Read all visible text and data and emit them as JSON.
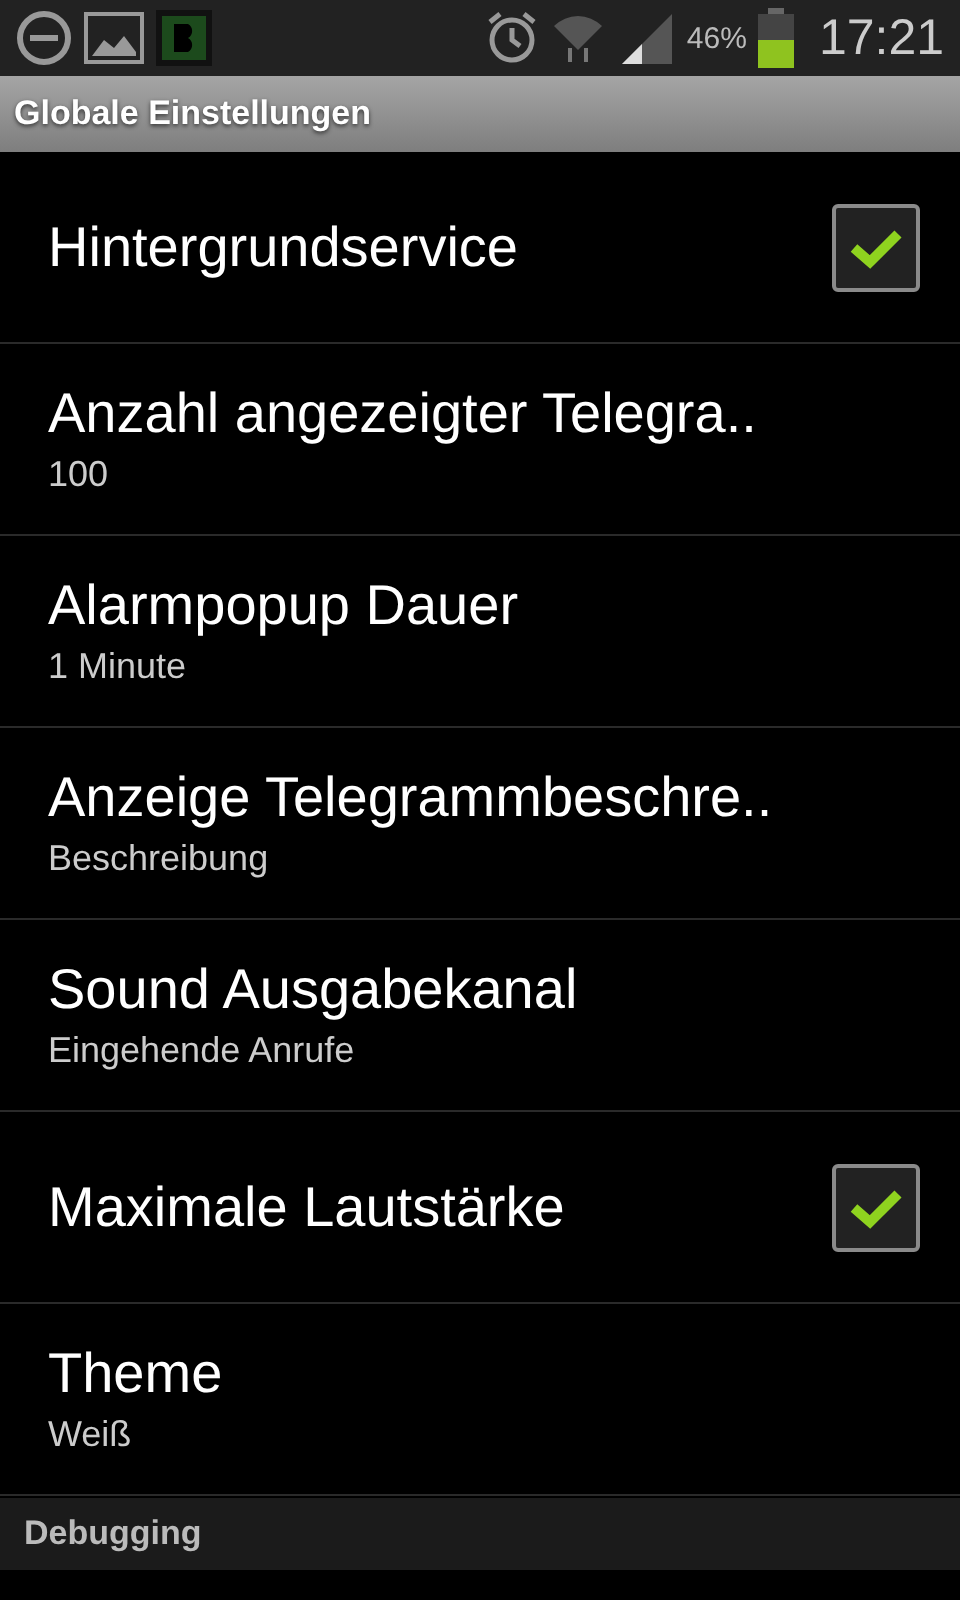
{
  "status_bar": {
    "battery": "46%",
    "time": "17:21"
  },
  "window": {
    "title": "Globale Einstellungen"
  },
  "settings": [
    {
      "kind": "checkbox",
      "title": "Hintergrundservice",
      "checked": true
    },
    {
      "kind": "value",
      "title": "Anzahl angezeigter Telegra..",
      "summary": "100"
    },
    {
      "kind": "value",
      "title": "Alarmpopup Dauer",
      "summary": "1 Minute"
    },
    {
      "kind": "value",
      "title": "Anzeige Telegrammbeschre..",
      "summary": "Beschreibung"
    },
    {
      "kind": "value",
      "title": "Sound Ausgabekanal",
      "summary": "Eingehende Anrufe"
    },
    {
      "kind": "checkbox",
      "title": "Maximale Lautstärke",
      "checked": true
    },
    {
      "kind": "value",
      "title": "Theme",
      "summary": "Weiß"
    }
  ],
  "sections": [
    {
      "title": "Debugging"
    }
  ]
}
